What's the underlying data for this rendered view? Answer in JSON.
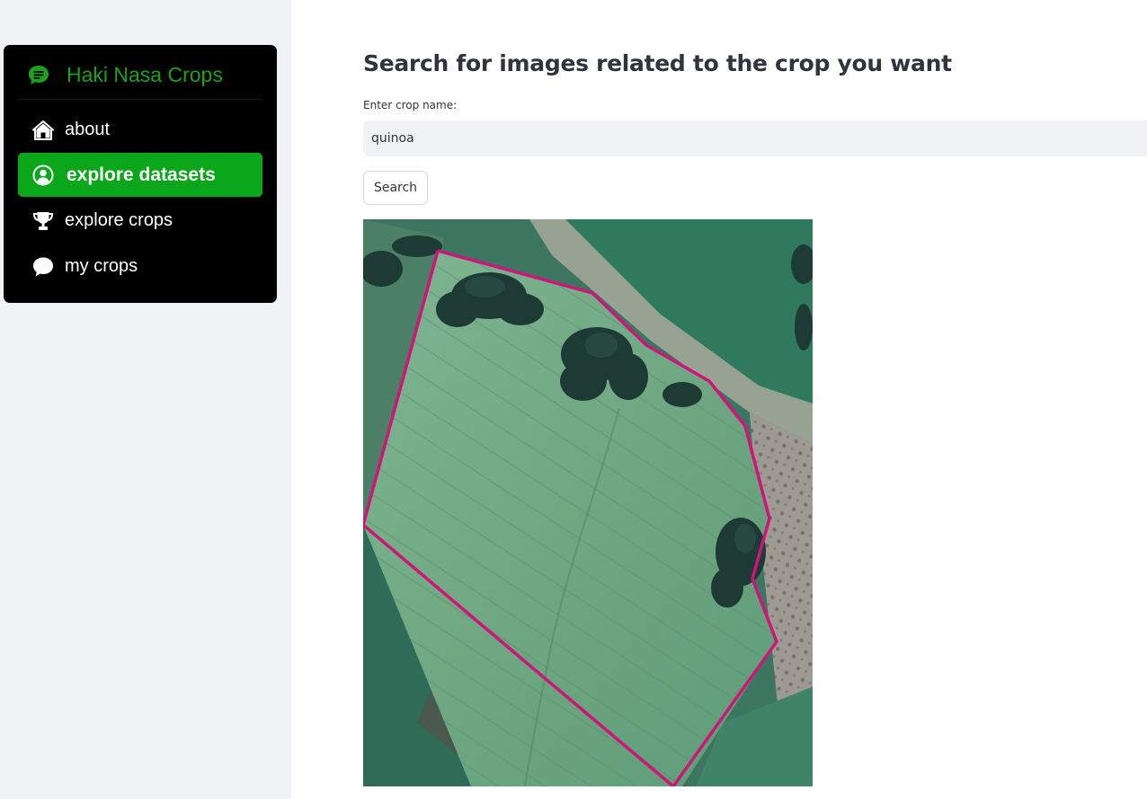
{
  "sidebar": {
    "header": {
      "title": "Haki Nasa Crops",
      "icon": "chat-icon"
    },
    "items": [
      {
        "label": "about",
        "icon": "house-icon",
        "active": false
      },
      {
        "label": "explore datasets",
        "icon": "person-circle-icon",
        "active": true
      },
      {
        "label": "explore crops",
        "icon": "trophy-icon",
        "active": false
      },
      {
        "label": "my crops",
        "icon": "chat-bubble-icon",
        "active": false
      }
    ]
  },
  "main": {
    "title": "Search for images related to the crop you want",
    "input": {
      "label": "Enter crop name:",
      "value": "quinoa"
    },
    "search_button": "Search",
    "image": {
      "type": "satellite field image with magenta boundary polygon"
    }
  },
  "colors": {
    "accent": "#0ba71b",
    "header_text": "#19a31b",
    "sidebar_bg": "#f0f2f6",
    "menu_bg": "#000000",
    "text": "#31333f",
    "boundary": "#d0157a"
  }
}
